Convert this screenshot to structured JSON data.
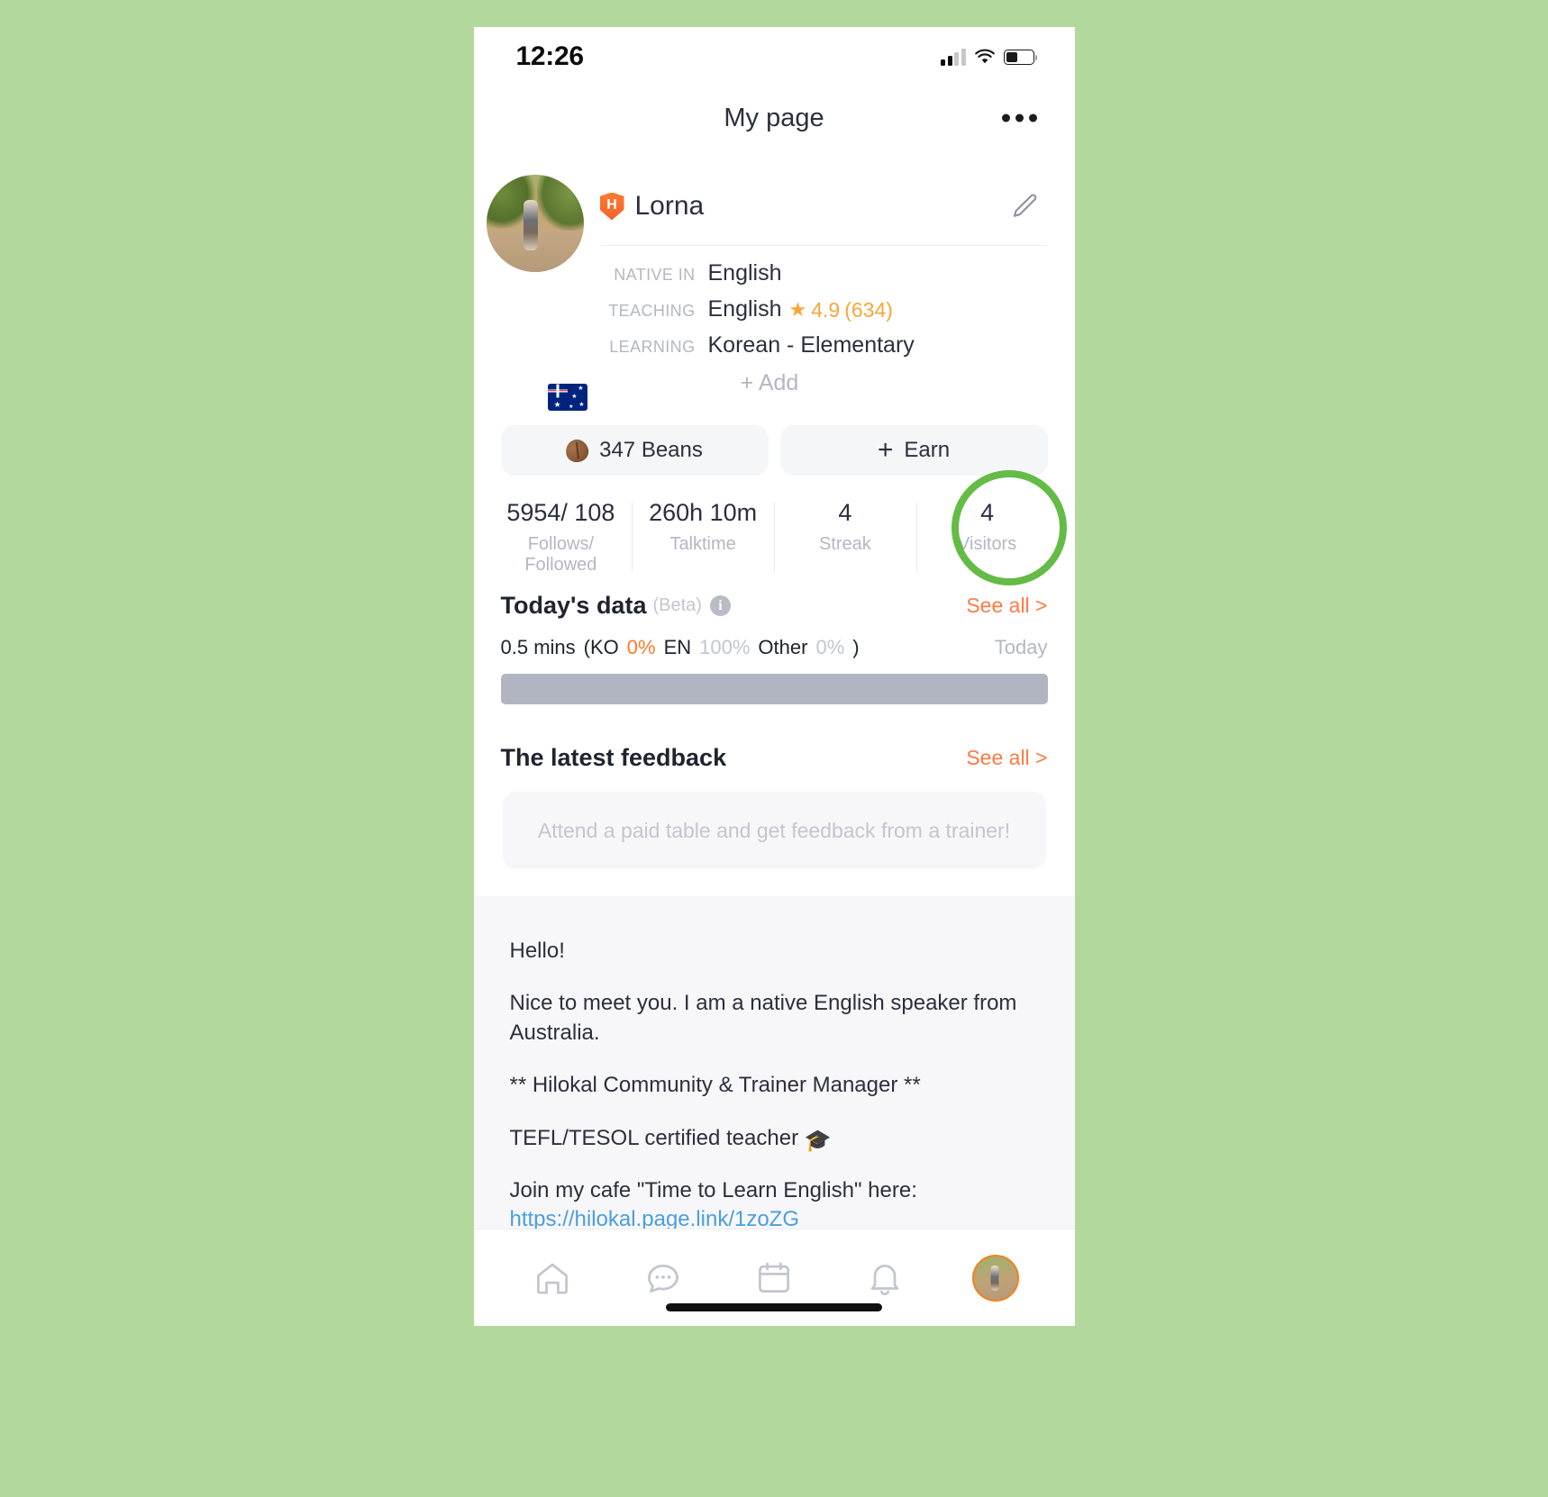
{
  "status_bar": {
    "time": "12:26",
    "signal_icon": "cellular-signal-icon",
    "wifi_icon": "wifi-icon",
    "battery_icon": "battery-icon"
  },
  "nav": {
    "title": "My page",
    "more_icon": "more-options-icon"
  },
  "profile": {
    "avatar_icon": "profile-avatar",
    "flag_icon": "australia-flag-icon",
    "badge_letter": "H",
    "name": "Lorna",
    "edit_icon": "edit-pencil-icon",
    "languages": [
      {
        "key": "NATIVE IN",
        "value": "English",
        "rating": "",
        "count": ""
      },
      {
        "key": "TEACHING",
        "value": "English",
        "rating": "4.9",
        "count": "(634)"
      },
      {
        "key": "LEARNING",
        "value": "Korean - Elementary",
        "rating": "",
        "count": ""
      }
    ],
    "add_label": "+ Add"
  },
  "beans": {
    "bean_icon": "coffee-bean-icon",
    "count_label": "347 Beans",
    "earn_icon": "plus-icon",
    "earn_label": "Earn"
  },
  "stats": [
    {
      "value": "5954/ 108",
      "label": "Follows/ Followed"
    },
    {
      "value": "260h 10m",
      "label": "Talktime"
    },
    {
      "value": "4",
      "label": "Streak"
    },
    {
      "value": "4",
      "label": "Visitors"
    }
  ],
  "highlight": {
    "target": "visitors-stat",
    "color": "#64bb46"
  },
  "today_data": {
    "title": "Today's data",
    "beta": "(Beta)",
    "info_icon": "info-icon",
    "see_all": "See all >",
    "mins": "0.5 mins",
    "open_paren": "(KO",
    "ko_pct": "0%",
    "en_label": "EN",
    "en_pct": "100%",
    "other_label": "Other",
    "other_pct": "0%",
    "close_paren": ")",
    "today_label": "Today",
    "bar_color": "#b0b5c1"
  },
  "feedback": {
    "title": "The latest feedback",
    "see_all": "See all >",
    "placeholder": "Attend a paid table and get feedback from a trainer!"
  },
  "bio": {
    "line1": "Hello!",
    "line2": "Nice to meet you. I am a native English speaker from Australia.",
    "line3": "** Hilokal Community & Trainer Manager **",
    "line4": "TEFL/TESOL certified teacher",
    "line4_emoji": "🎓",
    "line5": "Join my cafe \"Time to Learn English\" here:",
    "link": "https://hilokal.page.link/1zoZG"
  },
  "tabbar": {
    "items": [
      {
        "icon": "home-icon",
        "label": "Home"
      },
      {
        "icon": "chat-bubble-icon",
        "label": "Chat"
      },
      {
        "icon": "calendar-icon",
        "label": "Calendar"
      },
      {
        "icon": "bell-icon",
        "label": "Notifications"
      },
      {
        "icon": "profile-avatar-icon",
        "label": "Profile"
      }
    ]
  },
  "colors": {
    "accent_orange": "#ff7a45",
    "brand_orange": "#f2811d",
    "highlight_green": "#64bb46",
    "text_dark": "#2b2f3e",
    "text_muted": "#b4b7c2",
    "background_page": "#b3d89c"
  }
}
